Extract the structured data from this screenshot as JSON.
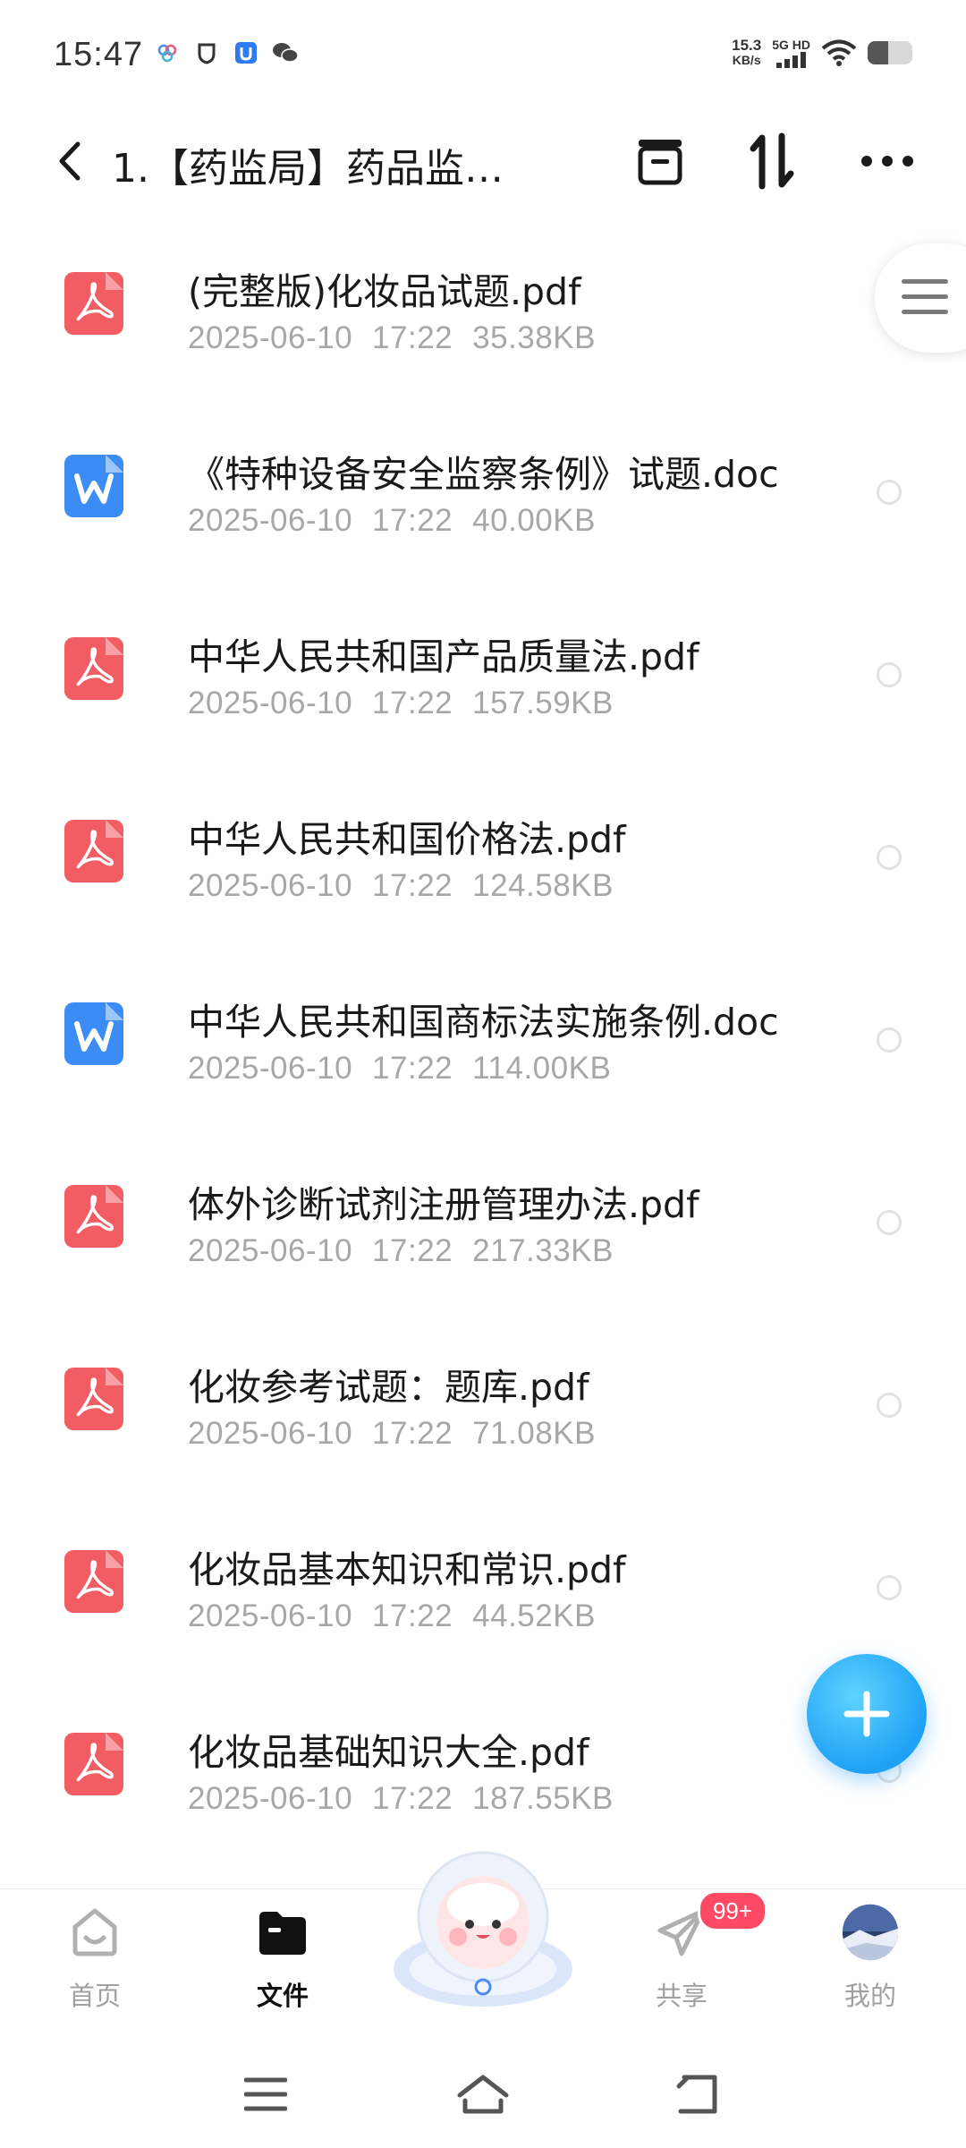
{
  "status_bar": {
    "time": "15:47",
    "net_speed_value": "15.3",
    "net_speed_unit": "KB/s",
    "signal_label": "5G HD",
    "battery_level": 0.45,
    "left_icons": [
      "app-badge-icon",
      "shield-icon",
      "lock-app-icon",
      "wechat-icon"
    ]
  },
  "header": {
    "title": "1.【药监局】药品监…",
    "actions": [
      "select-all-icon",
      "sort-icon",
      "more-icon"
    ]
  },
  "files": [
    {
      "name": "(完整版)化妆品试题.pdf",
      "type": "pdf",
      "date": "2025-06-10",
      "time": "17:22",
      "size": "35.38KB"
    },
    {
      "name": "《特种设备安全监察条例》试题.doc",
      "type": "doc",
      "date": "2025-06-10",
      "time": "17:22",
      "size": "40.00KB"
    },
    {
      "name": "中华人民共和国产品质量法.pdf",
      "type": "pdf",
      "date": "2025-06-10",
      "time": "17:22",
      "size": "157.59KB"
    },
    {
      "name": "中华人民共和国价格法.pdf",
      "type": "pdf",
      "date": "2025-06-10",
      "time": "17:22",
      "size": "124.58KB"
    },
    {
      "name": "中华人民共和国商标法实施条例.doc",
      "type": "doc",
      "date": "2025-06-10",
      "time": "17:22",
      "size": "114.00KB"
    },
    {
      "name": "体外诊断试剂注册管理办法.pdf",
      "type": "pdf",
      "date": "2025-06-10",
      "time": "17:22",
      "size": "217.33KB"
    },
    {
      "name": "化妆参考试题：题库.pdf",
      "type": "pdf",
      "date": "2025-06-10",
      "time": "17:22",
      "size": "71.08KB"
    },
    {
      "name": "化妆品基本知识和常识.pdf",
      "type": "pdf",
      "date": "2025-06-10",
      "time": "17:22",
      "size": "44.52KB"
    },
    {
      "name": "化妆品基础知识大全.pdf",
      "type": "pdf",
      "date": "2025-06-10",
      "time": "17:22",
      "size": "187.55KB"
    }
  ],
  "colors": {
    "pdf_icon": "#f25c63",
    "doc_icon": "#3b8cf5",
    "fab": "#2aa8f7",
    "badge": "#ff4a66"
  },
  "bottom_nav": {
    "items": [
      {
        "label": "首页",
        "icon": "home-face-icon",
        "active": false
      },
      {
        "label": "文件",
        "icon": "folder-icon",
        "active": true
      },
      {
        "label": "共享",
        "icon": "paper-plane-icon",
        "active": false
      },
      {
        "label": "我的",
        "icon": "avatar-icon",
        "active": false
      }
    ],
    "share_badge": "99+"
  },
  "system_nav": [
    "menu-icon",
    "home-icon",
    "back-icon"
  ]
}
